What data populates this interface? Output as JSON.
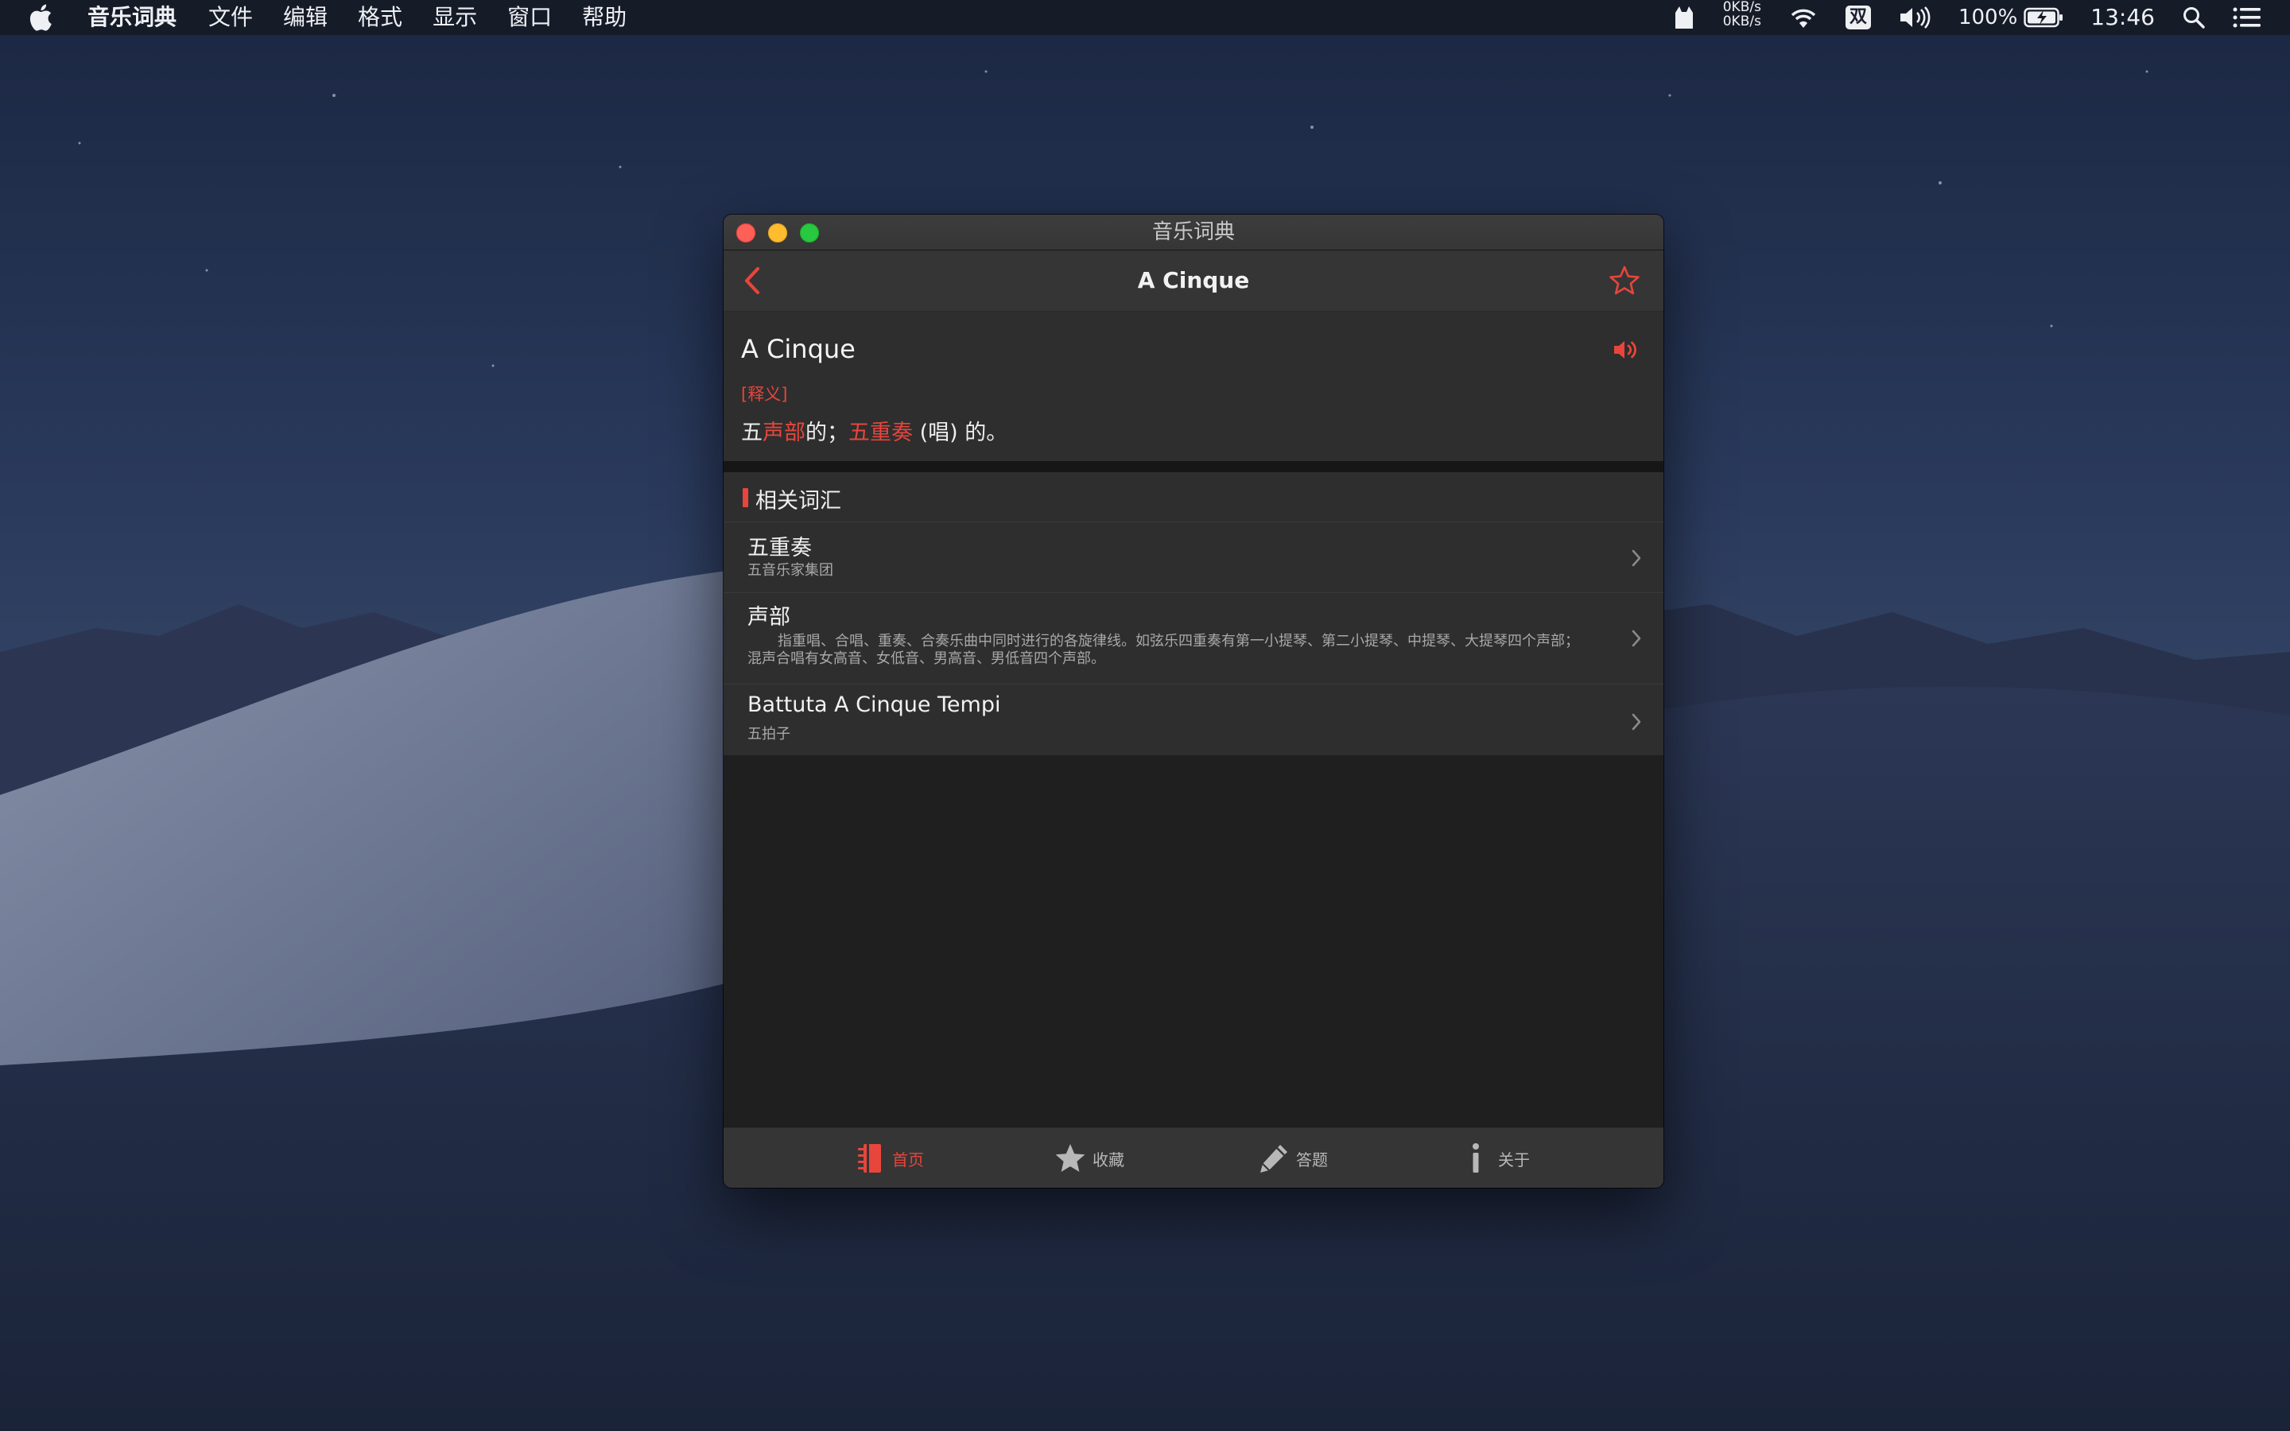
{
  "colors": {
    "accent": "#e8453c",
    "window_bg": "#1f1f1f",
    "card_bg": "#2e2e2e",
    "bar_bg": "#353535",
    "menubar_bg": "#161a26"
  },
  "menubar": {
    "items": [
      "音乐词典",
      "文件",
      "编辑",
      "格式",
      "显示",
      "窗口",
      "帮助"
    ],
    "net_up": "0KB/s",
    "net_down": "0KB/s",
    "ime": "双",
    "battery": "100%",
    "clock": "13:46",
    "icons": [
      "apple-icon",
      "cat-icon",
      "wifi-icon",
      "volume-icon",
      "battery-icon",
      "search-icon",
      "list-icon"
    ]
  },
  "window": {
    "title": "音乐词典"
  },
  "navbar": {
    "title": "A Cinque",
    "back_icon": "chevron-left-icon",
    "favorite_icon": "star-outline-icon"
  },
  "definition": {
    "term": "A Cinque",
    "tag": "[释义]",
    "meaning_parts": [
      "五",
      "声部",
      "的；",
      "五重奏",
      " (唱) 的。"
    ],
    "speaker_icon": "speaker-icon"
  },
  "related": {
    "title": "相关词汇",
    "items": [
      {
        "word": "五重奏",
        "desc": "五音乐家集团"
      },
      {
        "word": "声部",
        "desc_line1": "指重唱、合唱、重奏、合奏乐曲中同时进行的各旋律线。如弦乐四重奏有第一小提琴、第二小提琴、中提琴、大提琴四个声部；",
        "desc_line2": "混声合唱有女高音、女低音、男高音、男低音四个声部。"
      },
      {
        "word": "Battuta A Cinque Tempi",
        "desc": "五拍子"
      }
    ]
  },
  "tabbar": {
    "tabs": [
      {
        "label": "首页",
        "icon": "book-icon",
        "active": true
      },
      {
        "label": "收藏",
        "icon": "star-icon",
        "active": false
      },
      {
        "label": "答题",
        "icon": "pencil-icon",
        "active": false
      },
      {
        "label": "关于",
        "icon": "info-icon",
        "active": false
      }
    ]
  }
}
